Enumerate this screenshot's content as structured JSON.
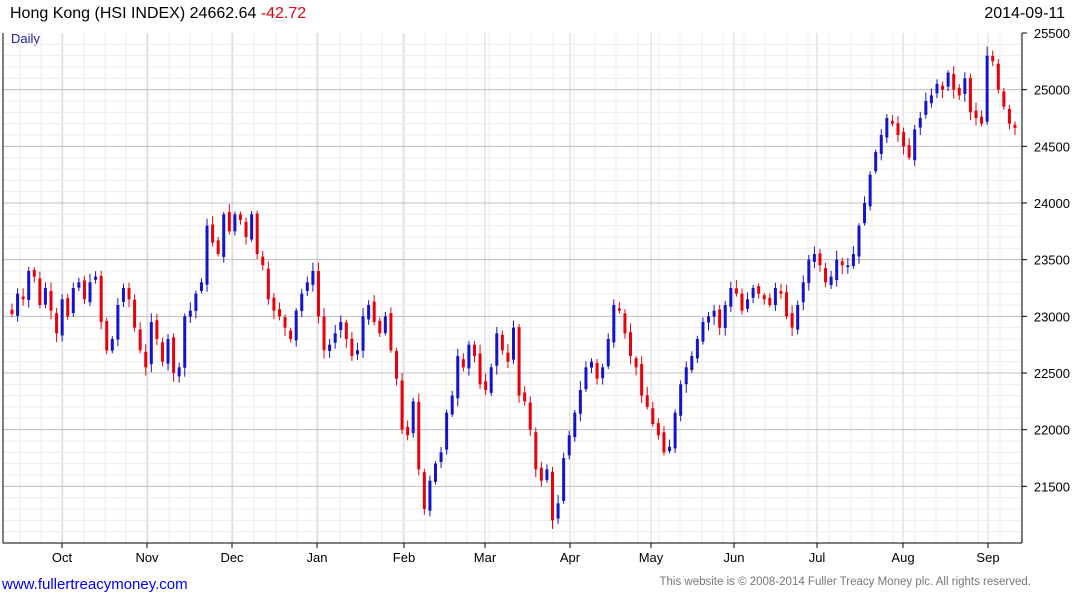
{
  "header": {
    "title": "Hong Kong (HSI INDEX)",
    "last": "24662.64",
    "change": "-42.72",
    "date": "2014-09-11"
  },
  "period_label": "Daily",
  "footer": {
    "link": "www.fullertreacymoney.com",
    "copyright": "This website is © 2008-2014 Fuller Treacy Money plc. All rights reserved."
  },
  "colors": {
    "up": "#1414c8",
    "down": "#e8000b",
    "grid": "#d4d4d4"
  },
  "chart_data": {
    "type": "candlestick",
    "title": "Hong Kong (HSI INDEX)",
    "period": "Daily",
    "x_ticks": [
      "Oct",
      "Nov",
      "Dec",
      "Jan",
      "Feb",
      "Mar",
      "Apr",
      "May",
      "Jun",
      "Jul",
      "Aug",
      "Sep"
    ],
    "y_ticks": [
      21500,
      22000,
      22500,
      23000,
      23500,
      24000,
      24500,
      25000,
      25500
    ],
    "ylim": [
      21000,
      25500
    ],
    "grid": true,
    "y_axis_side": "right",
    "approx_closes": [
      23020,
      23200,
      23150,
      23400,
      23350,
      23100,
      23250,
      23050,
      22850,
      23150,
      23000,
      23250,
      23300,
      23150,
      23300,
      23350,
      22950,
      22700,
      22800,
      23100,
      23250,
      23150,
      22900,
      22700,
      22550,
      22950,
      22800,
      22600,
      22800,
      22500,
      22550,
      23000,
      23050,
      23200,
      23300,
      23800,
      23650,
      23550,
      23900,
      23750,
      23900,
      23850,
      23700,
      23900,
      23550,
      23450,
      23150,
      23050,
      23000,
      22900,
      22800,
      23050,
      23200,
      23300,
      23400,
      23000,
      22700,
      22750,
      22850,
      22950,
      22800,
      22650,
      22700,
      23000,
      23100,
      22950,
      22850,
      23000,
      22700,
      22450,
      22000,
      21950,
      22250,
      21650,
      21300,
      21550,
      21700,
      21800,
      22150,
      22300,
      22650,
      22550,
      22750,
      22650,
      22400,
      22350,
      22550,
      22850,
      22700,
      22600,
      22900,
      22300,
      22250,
      22000,
      21650,
      21550,
      21650,
      21200,
      21350,
      21750,
      21950,
      22150,
      22350,
      22550,
      22600,
      22450,
      22550,
      22800,
      23100,
      23050,
      22850,
      22650,
      22550,
      22300,
      22200,
      22050,
      21950,
      21800,
      21850,
      22150,
      22400,
      22550,
      22650,
      22800,
      22950,
      23000,
      23050,
      22900,
      23100,
      23250,
      23200,
      23050,
      23150,
      23250,
      23200,
      23150,
      23100,
      23250,
      23200,
      23000,
      22900,
      23100,
      23300,
      23500,
      23550,
      23450,
      23300,
      23350,
      23500,
      23450,
      23450,
      23550,
      23800,
      24000,
      24250,
      24450,
      24600,
      24750,
      24700,
      24600,
      24500,
      24400,
      24650,
      24750,
      24900,
      24950,
      25050,
      25000,
      25150,
      25000,
      24950,
      25100,
      24800,
      24750,
      24700,
      25300,
      25250,
      25000,
      24850,
      24700,
      24662.64
    ]
  }
}
